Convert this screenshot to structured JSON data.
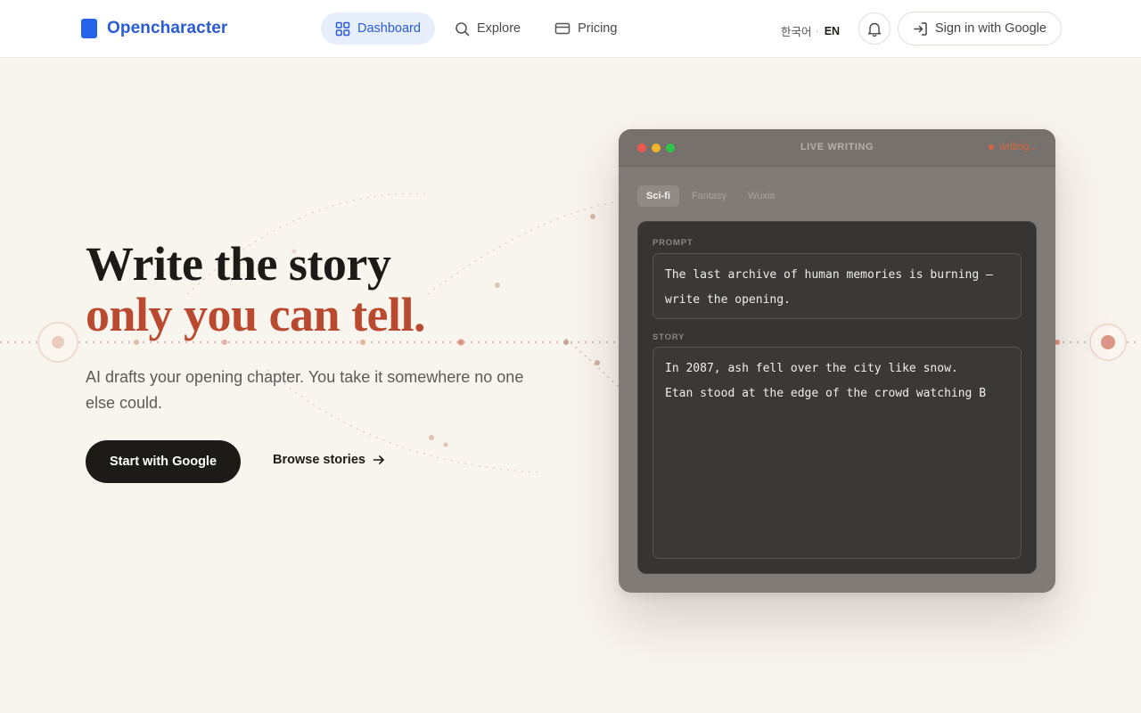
{
  "header": {
    "brand": "Opencharacter",
    "nav": [
      {
        "label": "Dashboard",
        "icon": "grid-icon",
        "active": true
      },
      {
        "label": "Explore",
        "icon": "search-icon"
      },
      {
        "label": "Pricing",
        "icon": "card-icon"
      }
    ],
    "lang_ko": "한국어",
    "lang_sep": "·",
    "lang_en": "EN",
    "signin_label": "Sign in with Google"
  },
  "hero": {
    "title_line1": "Write the story",
    "title_line2": "only you can tell.",
    "subtitle": "AI drafts your opening chapter. You take it somewhere no one else could.",
    "cta_primary": "Start with Google",
    "cta_secondary": "Browse stories"
  },
  "window": {
    "title": "LIVE WRITING",
    "status": "writing...",
    "tabs": [
      "Sci-fi",
      "Fantasy",
      "Wuxia"
    ],
    "active_tab": "Sci-fi",
    "prompt_label": "PROMPT",
    "prompt_line1": "The last archive of human memories is burning —",
    "prompt_line2": "write the opening.",
    "story_label": "STORY",
    "story_line1": "In 2087, ash fell over the city like snow.",
    "story_line2": "Etan stood at the edge of the crowd watching B"
  },
  "colors": {
    "brand": "#2563eb",
    "accent": "#b94a30",
    "background": "#f8f4ee",
    "window": "#807b76"
  }
}
